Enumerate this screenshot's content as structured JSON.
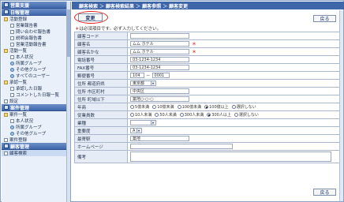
{
  "sidebar": {
    "sections": [
      {
        "header": "営業支援",
        "items": []
      },
      {
        "header": "日報管理",
        "items": [
          {
            "label": "活動登録",
            "level": 1,
            "icon": "folder"
          },
          {
            "label": "営業報告書",
            "level": 2,
            "icon": "doc"
          },
          {
            "label": "問い合わせ報告書",
            "level": 2,
            "icon": "doc"
          },
          {
            "label": "説明会報告書",
            "level": 2,
            "icon": "doc"
          },
          {
            "label": "営業活動報告書",
            "level": 2,
            "icon": "doc"
          },
          {
            "label": "活動一覧",
            "level": 1,
            "icon": "folder"
          },
          {
            "label": "本人状況",
            "level": 2,
            "icon": "doc"
          },
          {
            "label": "所属グループ",
            "level": 2,
            "icon": "grp"
          },
          {
            "label": "その他グループ",
            "level": 2,
            "icon": "grp"
          },
          {
            "label": "すべてのユーザー",
            "level": 2,
            "icon": "grp"
          },
          {
            "label": "承認一覧",
            "level": 1,
            "icon": "folder"
          },
          {
            "label": "承認した日報",
            "level": 2,
            "icon": "doc"
          },
          {
            "label": "コメントした日報一覧",
            "level": 2,
            "icon": "doc"
          },
          {
            "label": "設定",
            "level": 1,
            "icon": "doc"
          }
        ]
      },
      {
        "header": "案件管理",
        "items": [
          {
            "label": "案件一覧",
            "level": 1,
            "icon": "folder"
          },
          {
            "label": "本人状況",
            "level": 2,
            "icon": "doc"
          },
          {
            "label": "所属グループ",
            "level": 2,
            "icon": "grp"
          },
          {
            "label": "その他グループ",
            "level": 2,
            "icon": "grp"
          },
          {
            "label": "案件登録",
            "level": 1,
            "icon": "doc"
          }
        ]
      },
      {
        "header": "顧客管理",
        "items": [
          {
            "label": "顧客検索",
            "level": 1,
            "icon": "doc",
            "selected": true
          }
        ]
      }
    ]
  },
  "breadcrumb": [
    "顧客検索",
    "顧客検索結果",
    "顧客参照",
    "顧客変更"
  ],
  "toolbar": {
    "update_label": "変更",
    "back_label": "戻る"
  },
  "note": {
    "mark": "＊",
    "text": "は必須項目です。必ず入力してください。"
  },
  "form": {
    "rows": [
      {
        "label": "顧客コード",
        "type": "text",
        "value": ""
      },
      {
        "label": "顧客名",
        "type": "text",
        "value": "ムム ホテル",
        "required": true
      },
      {
        "label": "顧客名かな",
        "type": "text",
        "value": "ムム ホテル",
        "required": true
      },
      {
        "label": "電話番号",
        "type": "text",
        "value": "03-1234-1234"
      },
      {
        "label": "FAX番号",
        "type": "text",
        "value": "03-1234-1234"
      },
      {
        "label": "郵便番号",
        "type": "zip",
        "value1": "104",
        "value2": "0001"
      },
      {
        "label": "住所 都道府県",
        "type": "select",
        "value": "東京都"
      },
      {
        "label": "住所 市区町村",
        "type": "text",
        "value": "中央区"
      },
      {
        "label": "住所 町域以下",
        "type": "text",
        "value": "築地○-○-○"
      },
      {
        "label": "年商",
        "type": "radio",
        "options": [
          "5億未満",
          "10億未満",
          "100億未満",
          "100億以上",
          "選択しない"
        ],
        "selected": 3
      },
      {
        "label": "従業員数",
        "type": "radio",
        "options": [
          "10人未満",
          "50人未満",
          "300人未満",
          "300人以上",
          "選択しない"
        ],
        "selected": 3
      },
      {
        "label": "業種",
        "type": "select",
        "value": ""
      },
      {
        "label": "重要度",
        "type": "select",
        "value": "A"
      },
      {
        "label": "最寄駅",
        "type": "text",
        "value": "築地"
      },
      {
        "label": "ホームページ",
        "type": "text",
        "value": ""
      },
      {
        "label": "備考",
        "type": "textarea",
        "value": ""
      }
    ]
  },
  "bottom": {
    "back_label": "戻る"
  },
  "colors": {
    "header": "#3f66a9",
    "required": "#cc0000",
    "highlight": "#e0201c"
  }
}
